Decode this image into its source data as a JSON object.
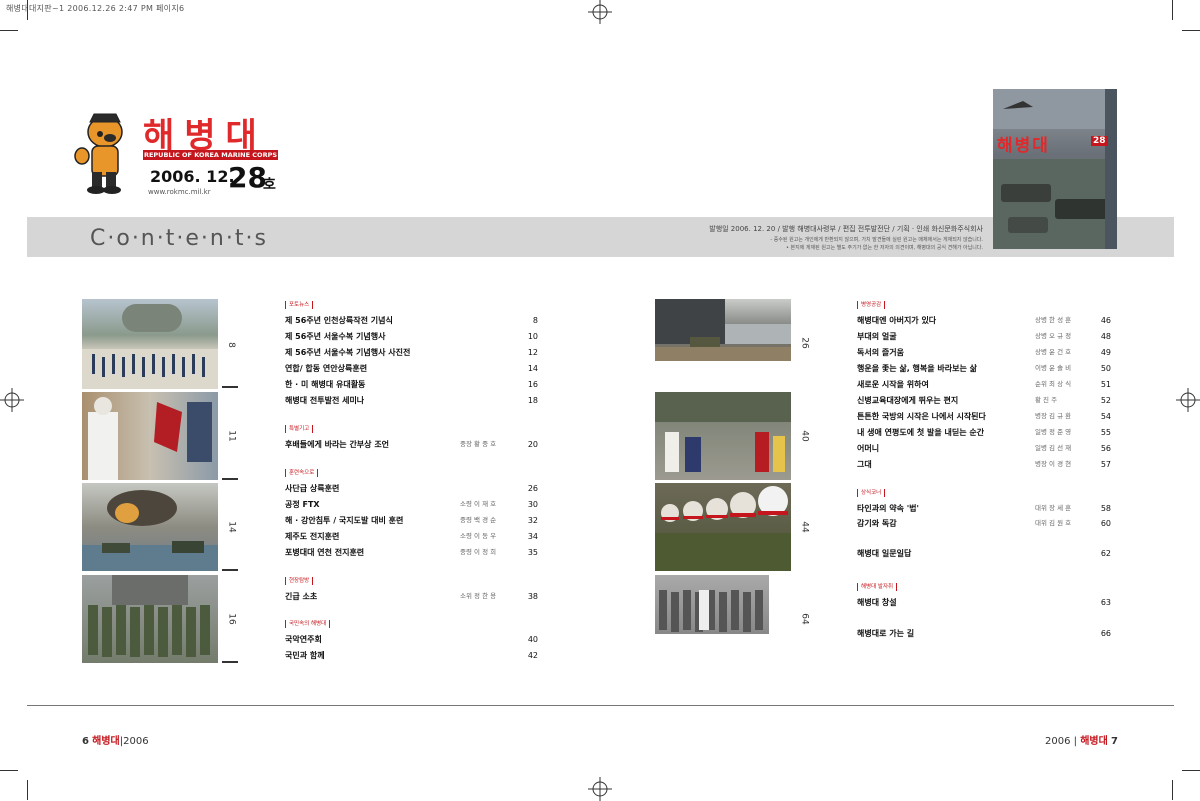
{
  "print_header": "해병대대지판~1  2006.12.26 2:47 PM  페이지6",
  "logo": {
    "title": "해병대",
    "banner": "REPUBLIC OF KOREA MARINE CORPS",
    "date": "2006. 12.",
    "issue_number": "28",
    "issue_suffix": "호",
    "website": "www.rokmc.mil.kr"
  },
  "contents_title": "C·o·n·t·e·n·t·s",
  "publication_info": "발행일  2006. 12. 20 / 발행 해병대사령부 / 편집 전투발전단 / 기획 · 인쇄 화신문화주식회사",
  "publication_notes": [
    "- 증수된 원고는 개인에게 반환되지 않으며, 가치 발견들에 실린 원고는 매체에서는 게재되지 않습니다.",
    "• 본지에 게재된 원고는 별도 주기가 없는 한 저자의 의견이며, 해병대의 공식 견해가 아닙니다."
  ],
  "cover": {
    "title": "해병대",
    "issue": "28"
  },
  "left_photos": [
    {
      "page": "8",
      "desc": "ceremony"
    },
    {
      "page": "11",
      "desc": "flag-bearers"
    },
    {
      "page": "14",
      "desc": "amphibious"
    },
    {
      "page": "16",
      "desc": "group"
    }
  ],
  "right_photos": [
    {
      "page": "26",
      "desc": "ship-landing"
    },
    {
      "page": "40",
      "desc": "performance"
    },
    {
      "page": "44",
      "desc": "helmets"
    },
    {
      "page": "64",
      "desc": "group-bw"
    }
  ],
  "left_sections": [
    {
      "tag": "포토뉴스",
      "entries": [
        {
          "title": "제 56주년 인천상륙작전 기념식",
          "author": "",
          "page": "8"
        },
        {
          "title": "제 56주년 서울수복 기념행사",
          "author": "",
          "page": "10"
        },
        {
          "title": "제 56주년 서울수복 기념행사 사진전",
          "author": "",
          "page": "12"
        },
        {
          "title": "연합/ 합동 연안상륙훈련",
          "author": "",
          "page": "14"
        },
        {
          "title": "한 · 미 해병대 유대활동",
          "author": "",
          "page": "16"
        },
        {
          "title": "해병대 전투발전 세미나",
          "author": "",
          "page": "18"
        }
      ]
    },
    {
      "tag": "특별기고",
      "entries": [
        {
          "title": "후배들에게 바라는 간부상 조언",
          "author": "중장 황 중 호",
          "page": "20"
        }
      ]
    },
    {
      "tag": "훈련속으로",
      "entries": [
        {
          "title": "사단급 상륙훈련",
          "author": "",
          "page": "26"
        },
        {
          "title": "공정 FTX",
          "author": "소령 이 재 호",
          "page": "30"
        },
        {
          "title": "해 · 강안침투 / 국지도발 대비 훈련",
          "author": "중령 백 경 순",
          "page": "32"
        },
        {
          "title": "제주도 전지훈련",
          "author": "소령 이 동 우",
          "page": "34"
        },
        {
          "title": "포병대대 연천 전지훈련",
          "author": "중령 이 정 희",
          "page": "35"
        }
      ]
    },
    {
      "tag": "현장탐방",
      "entries": [
        {
          "title": "긴급 소초",
          "author": "소위 정 한 용",
          "page": "38"
        }
      ]
    },
    {
      "tag": "국민속의 해병대",
      "entries": [
        {
          "title": "국악연주회",
          "author": "",
          "page": "40"
        },
        {
          "title": "국민과 함께",
          "author": "",
          "page": "42"
        }
      ]
    }
  ],
  "right_sections": [
    {
      "tag": "병영공감",
      "entries": [
        {
          "title": "해병대엔 아버지가 있다",
          "author": "상병 한 성 훈",
          "page": "46"
        },
        {
          "title": "부대의 얼굴",
          "author": "상병 오 규 정",
          "page": "48"
        },
        {
          "title": "독서의 즐거움",
          "author": "상병 윤 건 호",
          "page": "49"
        },
        {
          "title": "행운을 좇는 삶, 행복을 바라보는 삶",
          "author": "이병 윤 솔 비",
          "page": "50"
        },
        {
          "title": "새로운 시작을 위하여",
          "author": "순위 최 상 식",
          "page": "51"
        },
        {
          "title": "신병교육대장에게 뛰우는 편지",
          "author": "황 진 주",
          "page": "52"
        },
        {
          "title": "튼튼한 국방의 시작은 나에서 시작된다",
          "author": "병장 김 규 환",
          "page": "54"
        },
        {
          "title": "내 생애 연평도에 첫 발을 내딛는 순간",
          "author": "일병 정 준 영",
          "page": "55"
        },
        {
          "title": "어머니",
          "author": "일병 김 선 재",
          "page": "56"
        },
        {
          "title": "그대",
          "author": "병장 이 경 현",
          "page": "57"
        }
      ]
    },
    {
      "tag": "상식코너",
      "entries": [
        {
          "title": "타인과의 약속 '법'",
          "author": "대위 장 세 훈",
          "page": "58"
        },
        {
          "title": "감기와 독감",
          "author": "대위 김 원 호",
          "page": "60"
        }
      ]
    },
    {
      "tag": "",
      "entries": [
        {
          "title": "해병대 일문일답",
          "author": "",
          "page": "62"
        }
      ]
    },
    {
      "tag": "해병대 발자취",
      "entries": [
        {
          "title": "해병대 창설",
          "author": "",
          "page": "63"
        }
      ]
    },
    {
      "tag": "",
      "entries": [
        {
          "title": "해병대로 가는 길",
          "author": "",
          "page": "66"
        }
      ]
    }
  ],
  "footer": {
    "left_page": "6",
    "left_brand": "해병대",
    "left_year": "2006",
    "right_year": "2006",
    "right_brand": "해병대",
    "right_page": "7"
  }
}
